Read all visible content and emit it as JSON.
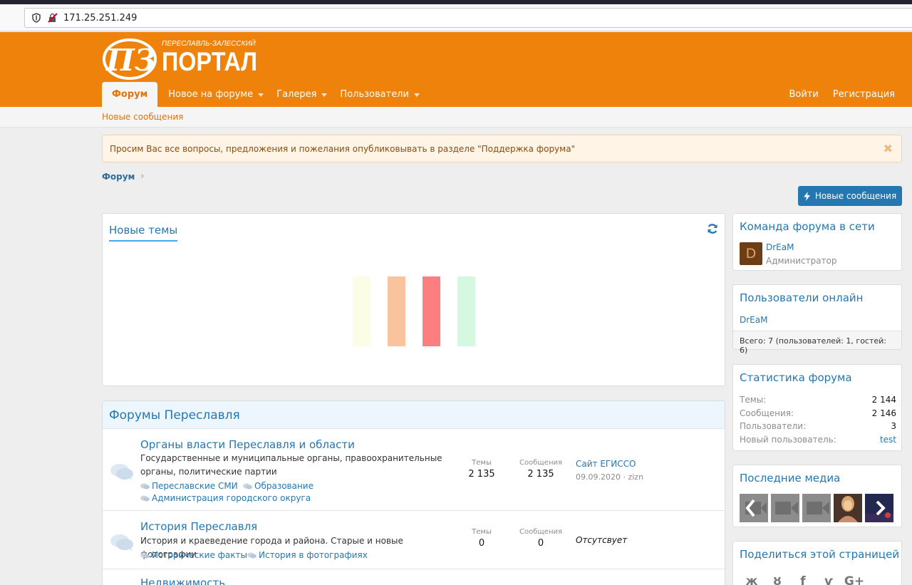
{
  "browser": {
    "url": "171.25.251.249"
  },
  "header": {
    "logo_subtitle": "ПЕРЕСЛАВЛЬ-ЗАЛЕССКИЙ",
    "logo_text": "ПОРТАЛ",
    "nav": [
      {
        "label": "Форум"
      },
      {
        "label": "Новое на форуме"
      },
      {
        "label": "Галерея"
      },
      {
        "label": "Пользователи"
      }
    ],
    "login": "Войти",
    "register": "Регистрация"
  },
  "subnav": {
    "new_posts": "Новые сообщения"
  },
  "notice": {
    "text": "Просим Вас все вопросы, предложения и пожелания опубликовывать в разделе \"Поддержка форума\"",
    "close": "✖"
  },
  "breadcrumb": {
    "root": "Форум",
    "sep": "›"
  },
  "new_posts_button": "Новые сообщения",
  "new_threads": {
    "tab": "Новые темы",
    "loader_colors": [
      "#fcfde7",
      "#f9c39e",
      "#fd7e80",
      "#d7f8e0"
    ]
  },
  "forums": {
    "title": "Форумы Переславля",
    "nodes": [
      {
        "title": "Органы власти Переславля и области",
        "desc": "Государственные и муниципальные органы, правоохранительные органы, политические партии",
        "subforums": [
          "Переславские СМИ",
          "Образование",
          "Администрация городского округа"
        ],
        "threads_label": "Темы",
        "threads": "2 135",
        "messages_label": "Сообщения",
        "messages": "2 135",
        "last_title": "Сайт ЕГИССО",
        "last_meta": "09.09.2020 · zizn"
      },
      {
        "title": "История Переславля",
        "desc": "История и краеведение города и района. Старые и новые фотографии",
        "subforums": [
          "Исторические факты",
          "История в фотографиях"
        ],
        "threads_label": "Темы",
        "threads": "0",
        "messages_label": "Сообщения",
        "messages": "0",
        "last_none": "Отсутсвует"
      },
      {
        "title": "Недвижимость"
      }
    ]
  },
  "sidebar": {
    "staff": {
      "title": "Команда форума в сети",
      "avatar_letter": "D",
      "name": "DrEaM",
      "role": "Администратор"
    },
    "online": {
      "title": "Пользователи онлайн",
      "name": "DrEaM",
      "total": "Всего: 7 (пользователей: 1, гостей: 6)"
    },
    "stats": {
      "title": "Статистика форума",
      "rows": [
        {
          "k": "Темы:",
          "v": "2 144"
        },
        {
          "k": "Сообщения:",
          "v": "2 146"
        },
        {
          "k": "Пользователи:",
          "v": "3"
        },
        {
          "k": "Новый пользователь:",
          "v": "test"
        }
      ]
    },
    "media": {
      "title": "Последние медиа"
    },
    "share": {
      "title": "Поделиться этой страницей",
      "icons": [
        "vk-icon",
        "odnoklassniki-icon",
        "facebook-icon",
        "twitter-icon",
        "google-plus-icon"
      ],
      "glyphs": [
        "ж",
        "ȣ",
        "f",
        "ѵ",
        "G+"
      ]
    }
  }
}
